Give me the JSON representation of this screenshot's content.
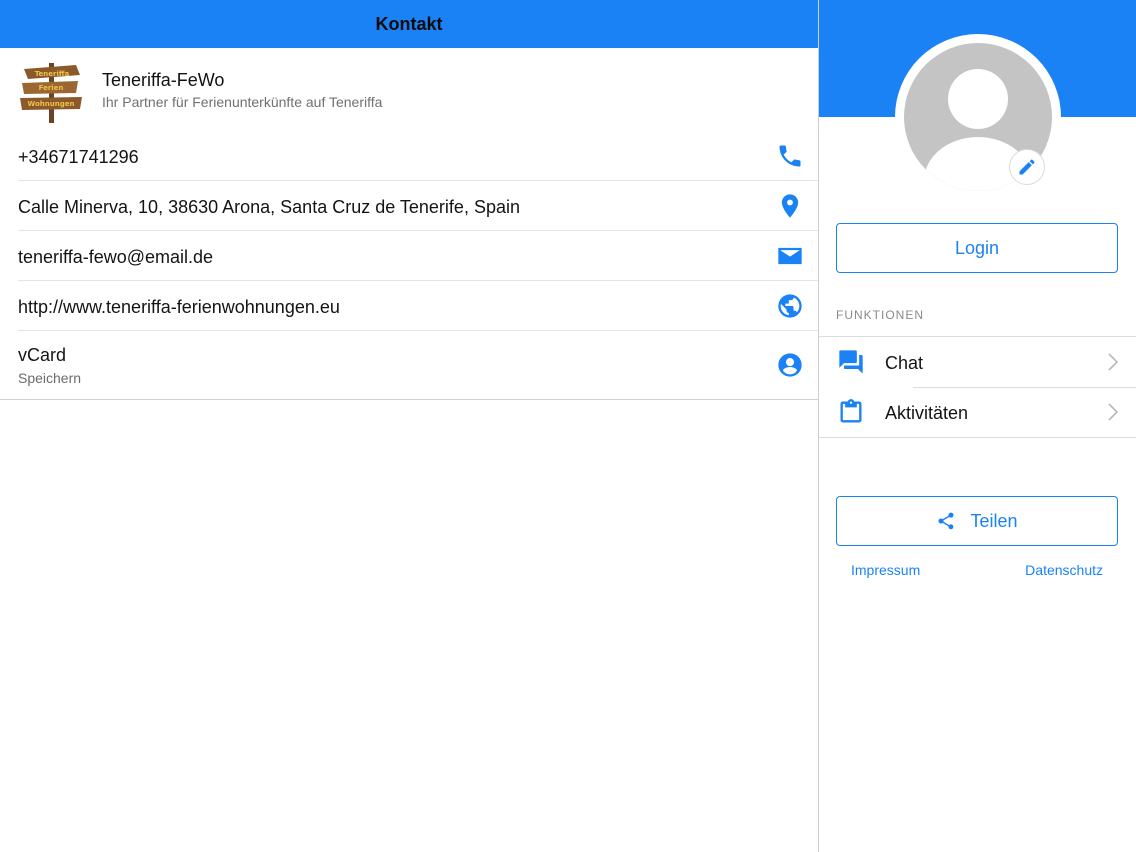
{
  "header": {
    "title": "Kontakt"
  },
  "brand": {
    "name": "Teneriffa-FeWo",
    "tagline": "Ihr Partner für Ferienunterkünfte auf Teneriffa",
    "logo_text": [
      "Teneriffa",
      "Ferien",
      "Wohnungen"
    ]
  },
  "contacts": [
    {
      "text": "+34671741296",
      "icon": "phone-icon"
    },
    {
      "text": "Calle Minerva, 10, 38630 Arona, Santa Cruz de Tenerife, Spain",
      "icon": "location-pin-icon"
    },
    {
      "text": "teneriffa-fewo@email.de",
      "icon": "mail-icon"
    },
    {
      "text": "http://www.teneriffa-ferienwohnungen.eu",
      "icon": "globe-icon"
    }
  ],
  "vcard": {
    "title": "vCard",
    "subtitle": "Speichern",
    "icon": "account-circle-icon"
  },
  "sidebar": {
    "login_label": "Login",
    "section_label": "FUNKTIONEN",
    "menu": [
      {
        "label": "Chat",
        "icon": "chat-icon"
      },
      {
        "label": "Aktivitäten",
        "icon": "clipboard-icon"
      }
    ],
    "share_label": "Teilen",
    "impressum_label": "Impressum",
    "datenschutz_label": "Datenschutz"
  },
  "colors": {
    "accent": "#1a82f4",
    "avatar_bg": "#c4c4c4",
    "divider": "#e4e4e4",
    "muted_text": "#707070"
  }
}
